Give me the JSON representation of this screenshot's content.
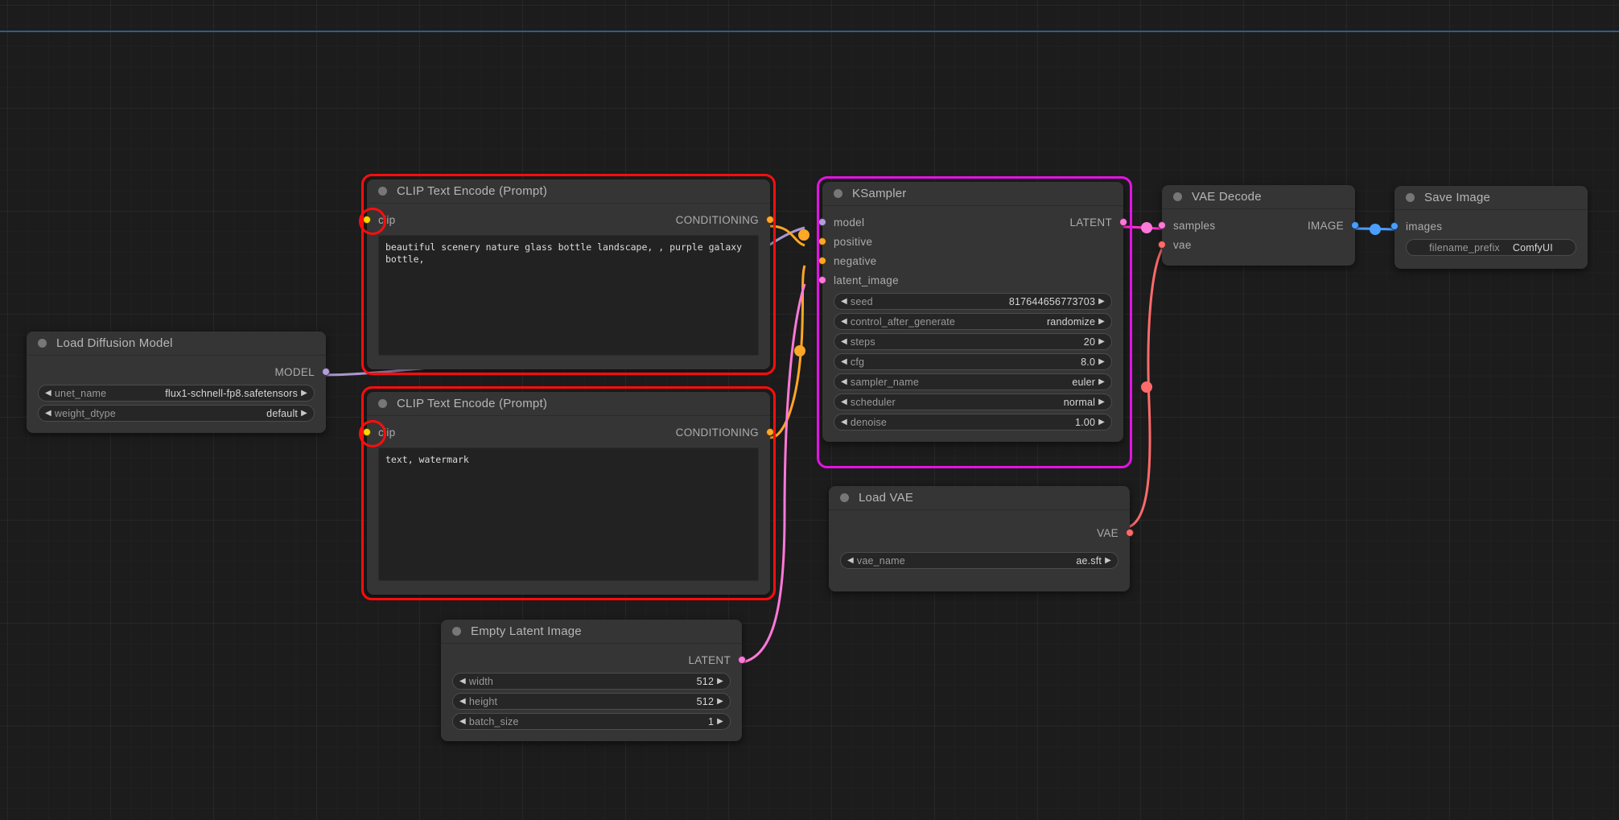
{
  "app": {
    "name": "ComfyUI",
    "canvas_background": "#1c1c1c",
    "highlight_color": "#ff0d0d",
    "selection_color": "#e313e3"
  },
  "nodes": {
    "load_diffusion_model": {
      "title": "Load Diffusion Model",
      "outputs": [
        {
          "label": "MODEL",
          "color": "#b39ddb"
        }
      ],
      "widgets": [
        {
          "name": "unet_name",
          "value": "flux1-schnell-fp8.safetensors"
        },
        {
          "name": "weight_dtype",
          "value": "default"
        }
      ]
    },
    "clip_positive": {
      "title": "CLIP Text Encode (Prompt)",
      "inputs": [
        {
          "label": "clip",
          "color": "#ffd500"
        }
      ],
      "outputs": [
        {
          "label": "CONDITIONING",
          "color": "#ffa726"
        }
      ],
      "text": "beautiful scenery nature glass bottle landscape, , purple galaxy bottle,"
    },
    "clip_negative": {
      "title": "CLIP Text Encode (Prompt)",
      "inputs": [
        {
          "label": "clip",
          "color": "#ffd500"
        }
      ],
      "outputs": [
        {
          "label": "CONDITIONING",
          "color": "#ffa726"
        }
      ],
      "text": "text, watermark"
    },
    "ksampler": {
      "title": "KSampler",
      "inputs": [
        {
          "label": "model",
          "color": "#b39ddb"
        },
        {
          "label": "positive",
          "color": "#ffa726"
        },
        {
          "label": "negative",
          "color": "#ffa726"
        },
        {
          "label": "latent_image",
          "color": "#ff79d8"
        }
      ],
      "outputs": [
        {
          "label": "LATENT",
          "color": "#ff79d8"
        }
      ],
      "widgets": [
        {
          "name": "seed",
          "value": "817644656773703"
        },
        {
          "name": "control_after_generate",
          "value": "randomize"
        },
        {
          "name": "steps",
          "value": "20"
        },
        {
          "name": "cfg",
          "value": "8.0"
        },
        {
          "name": "sampler_name",
          "value": "euler"
        },
        {
          "name": "scheduler",
          "value": "normal"
        },
        {
          "name": "denoise",
          "value": "1.00"
        }
      ]
    },
    "empty_latent_image": {
      "title": "Empty Latent Image",
      "outputs": [
        {
          "label": "LATENT",
          "color": "#ff79d8"
        }
      ],
      "widgets": [
        {
          "name": "width",
          "value": "512"
        },
        {
          "name": "height",
          "value": "512"
        },
        {
          "name": "batch_size",
          "value": "1"
        }
      ]
    },
    "load_vae": {
      "title": "Load VAE",
      "outputs": [
        {
          "label": "VAE",
          "color": "#ff6b6b"
        }
      ],
      "widgets": [
        {
          "name": "vae_name",
          "value": "ae.sft"
        }
      ]
    },
    "vae_decode": {
      "title": "VAE Decode",
      "inputs": [
        {
          "label": "samples",
          "color": "#ff79d8"
        },
        {
          "label": "vae",
          "color": "#ff6b6b"
        }
      ],
      "outputs": [
        {
          "label": "IMAGE",
          "color": "#4a9eff"
        }
      ]
    },
    "save_image": {
      "title": "Save Image",
      "inputs": [
        {
          "label": "images",
          "color": "#4a9eff"
        }
      ],
      "widgets": [
        {
          "name": "filename_prefix",
          "value": "ComfyUI"
        }
      ]
    }
  },
  "arrows": {
    "left": "◀",
    "right": "▶"
  }
}
